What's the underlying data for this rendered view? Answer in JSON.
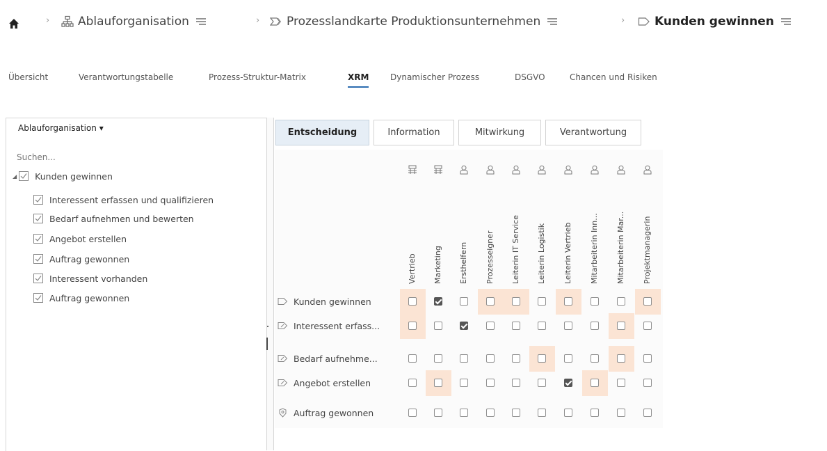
{
  "breadcrumb": {
    "items": [
      {
        "label": "Ablauforganisation",
        "icon": "org-chart-icon"
      },
      {
        "label": "Prozesslandkarte Produktionsunternehmen",
        "icon": "process-map-icon"
      },
      {
        "label": "Kunden gewinnen",
        "icon": "process-step-icon"
      }
    ]
  },
  "tabs": [
    {
      "label": "Übersicht"
    },
    {
      "label": "Verantwortungstabelle"
    },
    {
      "label": "Prozess-Struktur-Matrix"
    },
    {
      "label": "XRM",
      "active": true
    },
    {
      "label": "Dynamischer Prozess"
    },
    {
      "label": "DSGVO"
    },
    {
      "label": "Chancen und Risiken"
    }
  ],
  "left_panel": {
    "title": "Ablauforganisation ▾",
    "search_placeholder": "Suchen...",
    "tree": [
      {
        "label": "Kunden gewinnen",
        "level": 0,
        "checked": true
      },
      {
        "label": "Interessent erfassen und qualifizieren",
        "level": 1,
        "checked": true
      },
      {
        "label": "Bedarf aufnehmen und bewerten",
        "level": 1,
        "checked": true
      },
      {
        "label": "Angebot erstellen",
        "level": 1,
        "checked": true
      },
      {
        "label": "Auftrag gewonnen",
        "level": 1,
        "checked": true
      },
      {
        "label": "Interessent vorhanden",
        "level": 1,
        "checked": true
      },
      {
        "label": "Auftrag gewonnen",
        "level": 1,
        "checked": true
      }
    ]
  },
  "role_tabs": [
    {
      "label": "Entscheidung",
      "active": true
    },
    {
      "label": "Information"
    },
    {
      "label": "Mitwirkung"
    },
    {
      "label": "Verantwortung"
    }
  ],
  "matrix": {
    "columns": [
      {
        "label": "Vertrieb",
        "icon": "org-unit-icon"
      },
      {
        "label": "Marketing",
        "icon": "org-unit-icon"
      },
      {
        "label": "Ersthelfern",
        "icon": "role-icon"
      },
      {
        "label": "Prozesseigner",
        "icon": "role-icon"
      },
      {
        "label": "Leiterin IT Service",
        "icon": "role-icon"
      },
      {
        "label": "Leiterin Logistik",
        "icon": "role-icon"
      },
      {
        "label": "Leiterin Vertrieb",
        "icon": "role-icon"
      },
      {
        "label": "Mitarbeiterin Inn...",
        "icon": "role-icon"
      },
      {
        "label": "Mitarbeiterin Mar...",
        "icon": "role-icon"
      },
      {
        "label": "Projektmanagerin",
        "icon": "role-icon"
      }
    ],
    "rows": [
      {
        "label": "Kunden gewinnen",
        "icon": "process-step-icon",
        "checked": [
          1
        ],
        "highlight": [
          0,
          3,
          4,
          6,
          9
        ]
      },
      {
        "label": "Interessent erfass...",
        "icon": "activity-icon",
        "checked": [
          2
        ],
        "highlight": [
          0,
          8
        ]
      },
      {
        "label": "Bedarf aufnehme...",
        "icon": "activity-icon",
        "checked": [],
        "highlight": [
          5,
          8
        ]
      },
      {
        "label": "Angebot erstellen",
        "icon": "activity-icon",
        "checked": [
          6
        ],
        "highlight": [
          1,
          7
        ]
      },
      {
        "label": "Auftrag gewonnen",
        "icon": "event-icon",
        "checked": [],
        "highlight": []
      }
    ]
  }
}
